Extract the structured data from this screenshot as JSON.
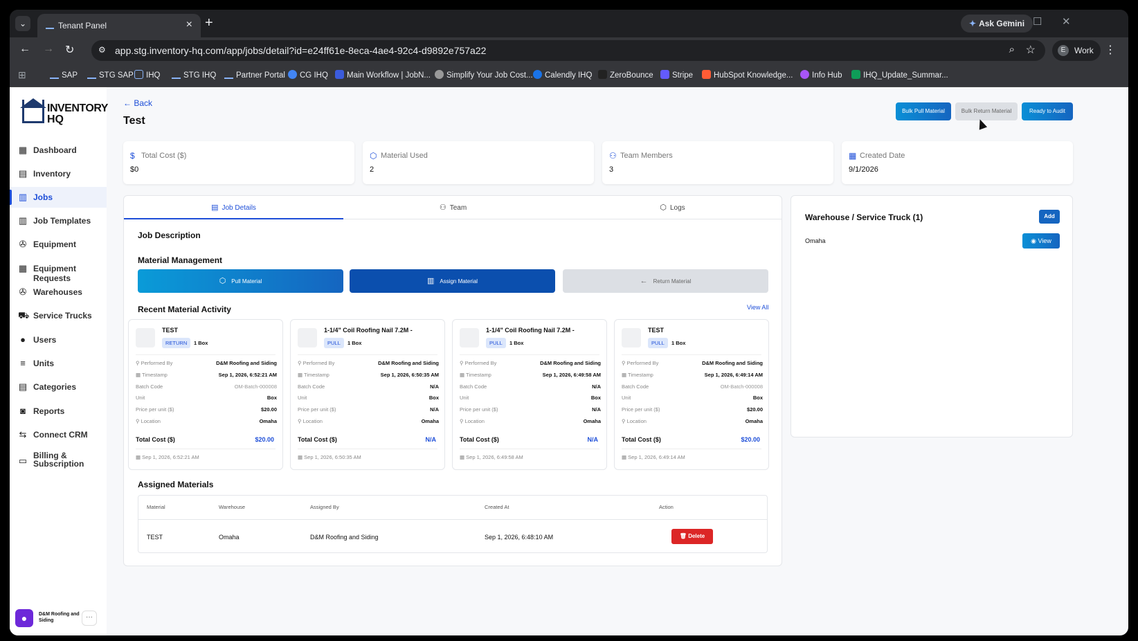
{
  "browser": {
    "tab_title": "Tenant Panel",
    "gemini_label": "Ask Gemini",
    "url": "app.stg.inventory-hq.com/app/jobs/detail?id=e24ff61e-8eca-4ae4-92c4-d9892e757a22",
    "profile_initial": "E",
    "profile_label": "Work",
    "bookmarks": [
      "SAP",
      "STG SAP",
      "IHQ",
      "STG IHQ",
      "Partner Portal",
      "CG IHQ",
      "Main Workflow | JobN...",
      "Simplify Your Job Cost...",
      "Calendly IHQ",
      "ZeroBounce",
      "Stripe",
      "HubSpot Knowledge...",
      "Info Hub",
      "IHQ_Update_Summar..."
    ]
  },
  "logo": {
    "line1": "INVENTORY",
    "line2": "HQ"
  },
  "sidebar": {
    "items": [
      {
        "label": "Dashboard",
        "icon": "dashboard-icon"
      },
      {
        "label": "Inventory",
        "icon": "inventory-icon"
      },
      {
        "label": "Jobs",
        "icon": "jobs-icon",
        "active": true
      },
      {
        "label": "Job Templates",
        "icon": "job-templates-icon"
      },
      {
        "label": "Equipment",
        "icon": "equipment-icon"
      },
      {
        "label": "Equipment Requests",
        "icon": "equipment-requests-icon"
      },
      {
        "label": "Warehouses",
        "icon": "warehouses-icon"
      },
      {
        "label": "Service Trucks",
        "icon": "truck-icon"
      },
      {
        "label": "Users",
        "icon": "users-icon"
      },
      {
        "label": "Units",
        "icon": "units-icon"
      },
      {
        "label": "Categories",
        "icon": "categories-icon"
      },
      {
        "label": "Reports",
        "icon": "reports-icon"
      },
      {
        "label": "Connect CRM",
        "icon": "crm-icon"
      },
      {
        "label": "Billing & Subscription",
        "icon": "billing-icon"
      }
    ],
    "user": "D&M Roofing and Siding"
  },
  "header": {
    "back": "Back",
    "title": "Test",
    "bulk_pull": "Bulk Pull Material",
    "bulk_return": "Bulk Return Material",
    "ready_audit": "Ready to Audit"
  },
  "stats": [
    {
      "label": "Total Cost ($)",
      "value": "$0",
      "icon": "dollar-icon"
    },
    {
      "label": "Material Used",
      "value": "2",
      "icon": "box-icon"
    },
    {
      "label": "Team Members",
      "value": "3",
      "icon": "team-icon"
    },
    {
      "label": "Created Date",
      "value": "9/1/2026",
      "icon": "calendar-icon"
    }
  ],
  "tabs": [
    "Job Details",
    "Team",
    "Logs"
  ],
  "job": {
    "description_title": "Job Description",
    "material_title": "Material Management",
    "pull_btn": "Pull Material",
    "assign_btn": "Assign Material",
    "return_btn": "Return Material",
    "activity_title": "Recent Material Activity",
    "view_all": "View All",
    "row_labels": {
      "performed_by": "Performed By",
      "timestamp": "Timestamp",
      "batch_code": "Batch Code",
      "unit": "Unit",
      "price": "Price per unit ($)",
      "location": "Location",
      "total": "Total Cost ($)"
    },
    "activity": [
      {
        "name": "TEST",
        "type": "RETURN",
        "qty": "1 Box",
        "performed_by": "D&M Roofing and Siding",
        "timestamp": "Sep 1, 2026, 6:52:21 AM",
        "batch_code": "OM-Batch-000008",
        "unit": "Box",
        "price": "$20.00",
        "location": "Omaha",
        "total": "$20.00",
        "footer": "Sep 1, 2026, 6:52:21 AM"
      },
      {
        "name": "1-1/4\" Coil Roofing Nail 7.2M -",
        "type": "PULL",
        "qty": "1 Box",
        "performed_by": "D&M Roofing and Siding",
        "timestamp": "Sep 1, 2026, 6:50:35 AM",
        "batch_code": "N/A",
        "unit": "Box",
        "price": "N/A",
        "location": "Omaha",
        "total": "N/A",
        "footer": "Sep 1, 2026, 6:50:35 AM"
      },
      {
        "name": "1-1/4\" Coil Roofing Nail 7.2M -",
        "type": "PULL",
        "qty": "1 Box",
        "performed_by": "D&M Roofing and Siding",
        "timestamp": "Sep 1, 2026, 6:49:58 AM",
        "batch_code": "N/A",
        "unit": "Box",
        "price": "N/A",
        "location": "Omaha",
        "total": "N/A",
        "footer": "Sep 1, 2026, 6:49:58 AM"
      },
      {
        "name": "TEST",
        "type": "PULL",
        "qty": "1 Box",
        "performed_by": "D&M Roofing and Siding",
        "timestamp": "Sep 1, 2026, 6:49:14 AM",
        "batch_code": "OM-Batch-000008",
        "unit": "Box",
        "price": "$20.00",
        "location": "Omaha",
        "total": "$20.00",
        "footer": "Sep 1, 2026, 6:49:14 AM"
      }
    ],
    "assigned_title": "Assigned Materials",
    "assigned_headers": [
      "Material",
      "Warehouse",
      "Assigned By",
      "Created At",
      "Action"
    ],
    "assigned_rows": [
      {
        "material": "TEST",
        "warehouse": "Omaha",
        "assigned_by": "D&M Roofing and Siding",
        "created_at": "Sep 1, 2026, 6:48:10 AM",
        "action": "Delete"
      }
    ]
  },
  "warehouse": {
    "title": "Warehouse / Service Truck (1)",
    "add": "Add",
    "items": [
      {
        "name": "Omaha",
        "view": "View"
      }
    ]
  }
}
